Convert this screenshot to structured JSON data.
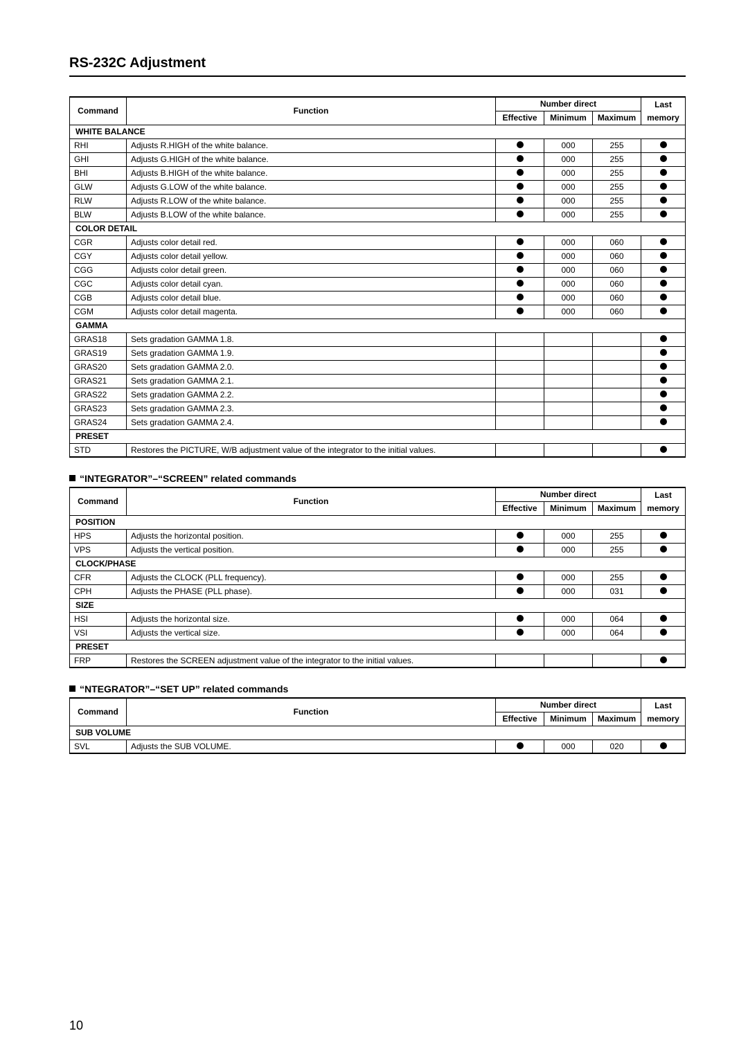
{
  "page_title": "RS-232C Adjustment",
  "page_number": "10",
  "header": {
    "command": "Command",
    "function": "Function",
    "number_direct": "Number direct",
    "effective": "Effective",
    "minimum": "Minimum",
    "maximum": "Maximum",
    "last_memory": "Last memory",
    "last": "Last",
    "memory": "memory"
  },
  "sections": [
    {
      "heading": null,
      "groups": [
        {
          "title": "WHITE BALANCE",
          "rows": [
            {
              "cmd": "RHI",
              "fn": "Adjusts R.HIGH of the white balance.",
              "eff": true,
              "min": "000",
              "max": "255",
              "last": true
            },
            {
              "cmd": "GHI",
              "fn": "Adjusts G.HIGH of the white balance.",
              "eff": true,
              "min": "000",
              "max": "255",
              "last": true
            },
            {
              "cmd": "BHI",
              "fn": "Adjusts B.HIGH of the white balance.",
              "eff": true,
              "min": "000",
              "max": "255",
              "last": true
            },
            {
              "cmd": "GLW",
              "fn": "Adjusts G.LOW of the white balance.",
              "eff": true,
              "min": "000",
              "max": "255",
              "last": true
            },
            {
              "cmd": "RLW",
              "fn": "Adjusts R.LOW of the white balance.",
              "eff": true,
              "min": "000",
              "max": "255",
              "last": true
            },
            {
              "cmd": "BLW",
              "fn": "Adjusts B.LOW of the white balance.",
              "eff": true,
              "min": "000",
              "max": "255",
              "last": true
            }
          ]
        },
        {
          "title": "COLOR DETAIL",
          "rows": [
            {
              "cmd": "CGR",
              "fn": "Adjusts color detail red.",
              "eff": true,
              "min": "000",
              "max": "060",
              "last": true
            },
            {
              "cmd": "CGY",
              "fn": "Adjusts color detail yellow.",
              "eff": true,
              "min": "000",
              "max": "060",
              "last": true
            },
            {
              "cmd": "CGG",
              "fn": "Adjusts color detail green.",
              "eff": true,
              "min": "000",
              "max": "060",
              "last": true
            },
            {
              "cmd": "CGC",
              "fn": "Adjusts color detail cyan.",
              "eff": true,
              "min": "000",
              "max": "060",
              "last": true
            },
            {
              "cmd": "CGB",
              "fn": "Adjusts color detail blue.",
              "eff": true,
              "min": "000",
              "max": "060",
              "last": true
            },
            {
              "cmd": "CGM",
              "fn": "Adjusts color detail magenta.",
              "eff": true,
              "min": "000",
              "max": "060",
              "last": true
            }
          ]
        },
        {
          "title": "GAMMA",
          "rows": [
            {
              "cmd": "GRAS18",
              "fn": "Sets gradation GAMMA 1.8.",
              "eff": false,
              "min": "",
              "max": "",
              "last": true
            },
            {
              "cmd": "GRAS19",
              "fn": "Sets gradation GAMMA 1.9.",
              "eff": false,
              "min": "",
              "max": "",
              "last": true
            },
            {
              "cmd": "GRAS20",
              "fn": "Sets gradation GAMMA 2.0.",
              "eff": false,
              "min": "",
              "max": "",
              "last": true
            },
            {
              "cmd": "GRAS21",
              "fn": "Sets gradation GAMMA 2.1.",
              "eff": false,
              "min": "",
              "max": "",
              "last": true
            },
            {
              "cmd": "GRAS22",
              "fn": "Sets gradation GAMMA 2.2.",
              "eff": false,
              "min": "",
              "max": "",
              "last": true
            },
            {
              "cmd": "GRAS23",
              "fn": "Sets gradation GAMMA 2.3.",
              "eff": false,
              "min": "",
              "max": "",
              "last": true
            },
            {
              "cmd": "GRAS24",
              "fn": "Sets gradation GAMMA 2.4.",
              "eff": false,
              "min": "",
              "max": "",
              "last": true
            }
          ]
        },
        {
          "title": "PRESET",
          "rows": [
            {
              "cmd": "STD",
              "fn": "Restores the PICTURE, W/B adjustment value of the integrator to the initial values.",
              "eff": false,
              "min": "",
              "max": "",
              "last": true
            }
          ]
        }
      ]
    },
    {
      "heading": "“INTEGRATOR”–“SCREEN” related commands",
      "groups": [
        {
          "title": "POSITION",
          "rows": [
            {
              "cmd": "HPS",
              "fn": "Adjusts the horizontal position.",
              "eff": true,
              "min": "000",
              "max": "255",
              "last": true
            },
            {
              "cmd": "VPS",
              "fn": "Adjusts the vertical position.",
              "eff": true,
              "min": "000",
              "max": "255",
              "last": true
            }
          ]
        },
        {
          "title": "CLOCK/PHASE",
          "rows": [
            {
              "cmd": "CFR",
              "fn": "Adjusts the CLOCK (PLL frequency).",
              "eff": true,
              "min": "000",
              "max": "255",
              "last": true
            },
            {
              "cmd": "CPH",
              "fn": "Adjusts the PHASE (PLL phase).",
              "eff": true,
              "min": "000",
              "max": "031",
              "last": true
            }
          ]
        },
        {
          "title": "SIZE",
          "rows": [
            {
              "cmd": "HSI",
              "fn": "Adjusts the horizontal size.",
              "eff": true,
              "min": "000",
              "max": "064",
              "last": true
            },
            {
              "cmd": "VSI",
              "fn": "Adjusts the vertical size.",
              "eff": true,
              "min": "000",
              "max": "064",
              "last": true
            }
          ]
        },
        {
          "title": "PRESET",
          "rows": [
            {
              "cmd": "FRP",
              "fn": "Restores the SCREEN adjustment value of the integrator to the initial values.",
              "eff": false,
              "min": "",
              "max": "",
              "last": true
            }
          ]
        }
      ]
    },
    {
      "heading": "“NTEGRATOR”–“SET UP” related commands",
      "groups": [
        {
          "title": "SUB VOLUME",
          "rows": [
            {
              "cmd": "SVL",
              "fn": "Adjusts the SUB VOLUME.",
              "eff": true,
              "min": "000",
              "max": "020",
              "last": true
            }
          ]
        }
      ]
    }
  ]
}
